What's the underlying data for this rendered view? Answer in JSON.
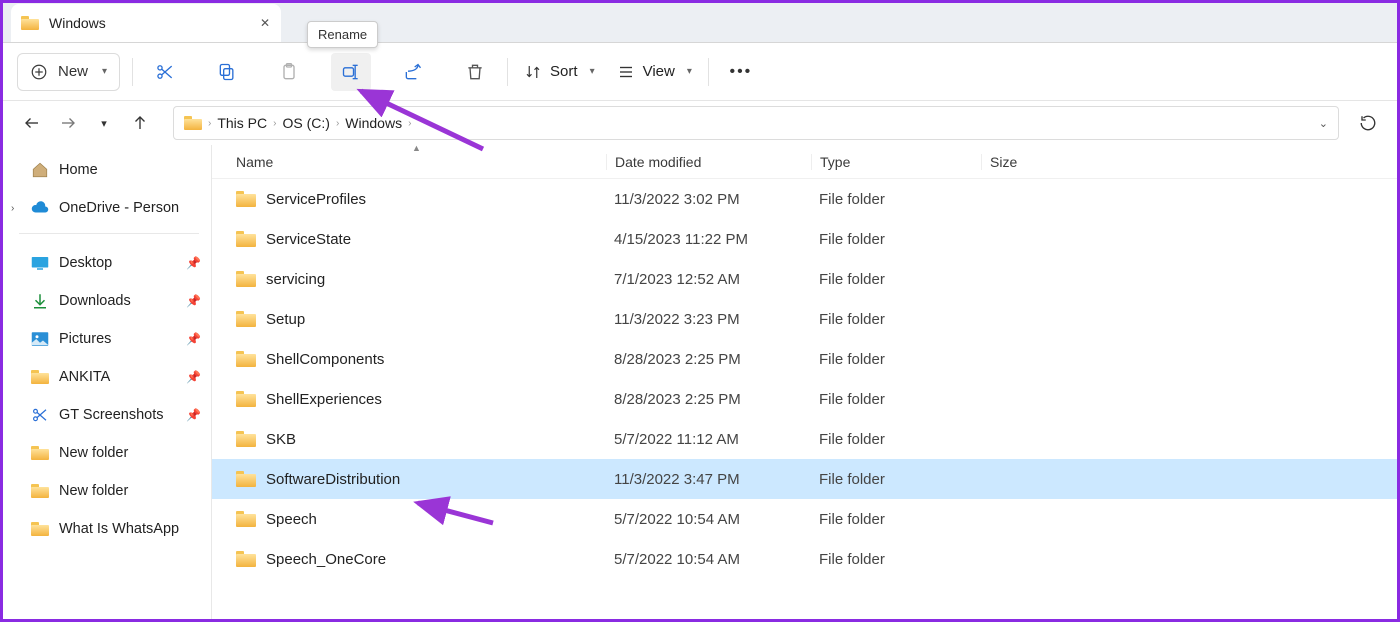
{
  "tab": {
    "title": "Windows"
  },
  "tooltip": {
    "rename": "Rename"
  },
  "toolbar": {
    "new_label": "New",
    "sort_label": "Sort",
    "view_label": "View"
  },
  "breadcrumb": [
    "This PC",
    "OS (C:)",
    "Windows"
  ],
  "sidebar": {
    "home": "Home",
    "onedrive": "OneDrive - Person",
    "quick": [
      "Desktop",
      "Downloads",
      "Pictures",
      "ANKITA",
      "GT Screenshots",
      "New folder",
      "New folder",
      "What Is WhatsApp"
    ]
  },
  "columns": {
    "name": "Name",
    "date": "Date modified",
    "type": "Type",
    "size": "Size"
  },
  "files": [
    {
      "name": "ServiceProfiles",
      "date": "11/3/2022 3:02 PM",
      "type": "File folder",
      "selected": false
    },
    {
      "name": "ServiceState",
      "date": "4/15/2023 11:22 PM",
      "type": "File folder",
      "selected": false
    },
    {
      "name": "servicing",
      "date": "7/1/2023 12:52 AM",
      "type": "File folder",
      "selected": false
    },
    {
      "name": "Setup",
      "date": "11/3/2022 3:23 PM",
      "type": "File folder",
      "selected": false
    },
    {
      "name": "ShellComponents",
      "date": "8/28/2023 2:25 PM",
      "type": "File folder",
      "selected": false
    },
    {
      "name": "ShellExperiences",
      "date": "8/28/2023 2:25 PM",
      "type": "File folder",
      "selected": false
    },
    {
      "name": "SKB",
      "date": "5/7/2022 11:12 AM",
      "type": "File folder",
      "selected": false
    },
    {
      "name": "SoftwareDistribution",
      "date": "11/3/2022 3:47 PM",
      "type": "File folder",
      "selected": true
    },
    {
      "name": "Speech",
      "date": "5/7/2022 10:54 AM",
      "type": "File folder",
      "selected": false
    },
    {
      "name": "Speech_OneCore",
      "date": "5/7/2022 10:54 AM",
      "type": "File folder",
      "selected": false
    }
  ]
}
